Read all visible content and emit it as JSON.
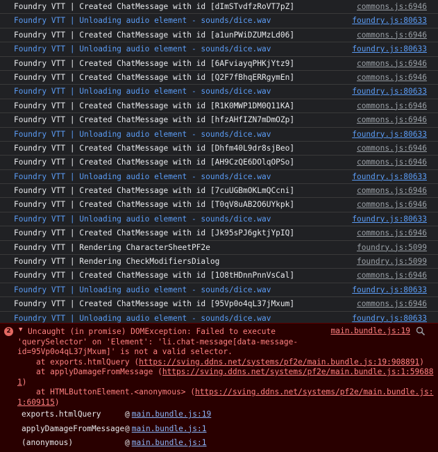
{
  "console_rows": [
    {
      "type": "log",
      "text": "Foundry VTT | Created ChatMessage with id [dImSTvdfzRoVT7pZ]",
      "source": "commons.js:6946"
    },
    {
      "type": "info",
      "text": "Foundry VTT | Unloading audio element - sounds/dice.wav",
      "source": "foundry.js:80633"
    },
    {
      "type": "log",
      "text": "Foundry VTT | Created ChatMessage with id [a1unPWiDZUMzLd06]",
      "source": "commons.js:6946"
    },
    {
      "type": "info",
      "text": "Foundry VTT | Unloading audio element - sounds/dice.wav",
      "source": "foundry.js:80633"
    },
    {
      "type": "log",
      "text": "Foundry VTT | Created ChatMessage with id [6AFviayqPHKjYtz9]",
      "source": "commons.js:6946"
    },
    {
      "type": "log",
      "text": "Foundry VTT | Created ChatMessage with id [Q2F7fBhqERRgymEn]",
      "source": "commons.js:6946"
    },
    {
      "type": "info",
      "text": "Foundry VTT | Unloading audio element - sounds/dice.wav",
      "source": "foundry.js:80633"
    },
    {
      "type": "log",
      "text": "Foundry VTT | Created ChatMessage with id [R1K0MWP1DM0Q11KA]",
      "source": "commons.js:6946"
    },
    {
      "type": "log",
      "text": "Foundry VTT | Created ChatMessage with id [hfzAHfIZN7mDmOZp]",
      "source": "commons.js:6946"
    },
    {
      "type": "info",
      "text": "Foundry VTT | Unloading audio element - sounds/dice.wav",
      "source": "foundry.js:80633"
    },
    {
      "type": "log",
      "text": "Foundry VTT | Created ChatMessage with id [Dhfm40L9dr8sjBeo]",
      "source": "commons.js:6946"
    },
    {
      "type": "log",
      "text": "Foundry VTT | Created ChatMessage with id [AH9CzQE6DOlqOPSo]",
      "source": "commons.js:6946"
    },
    {
      "type": "info",
      "text": "Foundry VTT | Unloading audio element - sounds/dice.wav",
      "source": "foundry.js:80633"
    },
    {
      "type": "log",
      "text": "Foundry VTT | Created ChatMessage with id [7cuUGBmOKLmQCcni]",
      "source": "commons.js:6946"
    },
    {
      "type": "log",
      "text": "Foundry VTT | Created ChatMessage with id [T0qV8uAB2O6UYkpk]",
      "source": "commons.js:6946"
    },
    {
      "type": "info",
      "text": "Foundry VTT | Unloading audio element - sounds/dice.wav",
      "source": "foundry.js:80633"
    },
    {
      "type": "log",
      "text": "Foundry VTT | Created ChatMessage with id [Jk95sPJ6gktjYpIQ]",
      "source": "commons.js:6946"
    },
    {
      "type": "log",
      "text": "Foundry VTT | Rendering CharacterSheetPF2e",
      "source": "foundry.js:5099"
    },
    {
      "type": "log",
      "text": "Foundry VTT | Rendering CheckModifiersDialog",
      "source": "foundry.js:5099"
    },
    {
      "type": "log",
      "text": "Foundry VTT | Created ChatMessage with id [1O8tHDnnPnnVsCal]",
      "source": "commons.js:6946"
    },
    {
      "type": "info",
      "text": "Foundry VTT | Unloading audio element - sounds/dice.wav",
      "source": "foundry.js:80633"
    },
    {
      "type": "log",
      "text": "Foundry VTT | Created ChatMessage with id [95Vp0o4qL37jMxum]",
      "source": "commons.js:6946"
    },
    {
      "type": "info",
      "text": "Foundry VTT | Unloading audio element - sounds/dice.wav",
      "source": "foundry.js:80633"
    }
  ],
  "error": {
    "count": "2",
    "source": "main.bundle.js:19",
    "search_icon": "search-icon",
    "message_lines": [
      "Uncaught (in promise) DOMException: Failed to execute",
      "'querySelector' on 'Element': 'li.chat-message[data-message-",
      "id=95Vp0o4qL37jMxum]' is not a valid selector."
    ],
    "trace": [
      {
        "prefix": "    at exports.htmlQuery (",
        "link": "https://sving.ddns.net/systems/pf2e/main.bundle.js:19:908891",
        "suffix": ")"
      },
      {
        "prefix": "    at applyDamageFromMessage (",
        "link": "https://sving.ddns.net/systems/pf2e/main.bundle.js:1:59688",
        "suffix": ""
      },
      {
        "prefix": "",
        "link": "1",
        "suffix": ")"
      },
      {
        "prefix": "    at HTMLButtonElement.<anonymous> (",
        "link": "https://sving.ddns.net/systems/pf2e/main.bundle.js:",
        "suffix": ""
      },
      {
        "prefix": "",
        "link": "1:609115",
        "suffix": ")"
      }
    ],
    "stack": [
      {
        "fn": "exports.htmlQuery",
        "at": "@",
        "loc": "main.bundle.js:19"
      },
      {
        "fn": "applyDamageFromMessage",
        "at": "@",
        "loc": "main.bundle.js:1"
      },
      {
        "fn": "(anonymous)",
        "at": "@",
        "loc": "main.bundle.js:1"
      }
    ]
  },
  "colors": {
    "background": "#202124",
    "log_text": "#e8eaed",
    "info_text": "#5b9cf5",
    "error_bg": "#290000",
    "error_text": "#ff8080",
    "link": "#8ab4f8"
  }
}
